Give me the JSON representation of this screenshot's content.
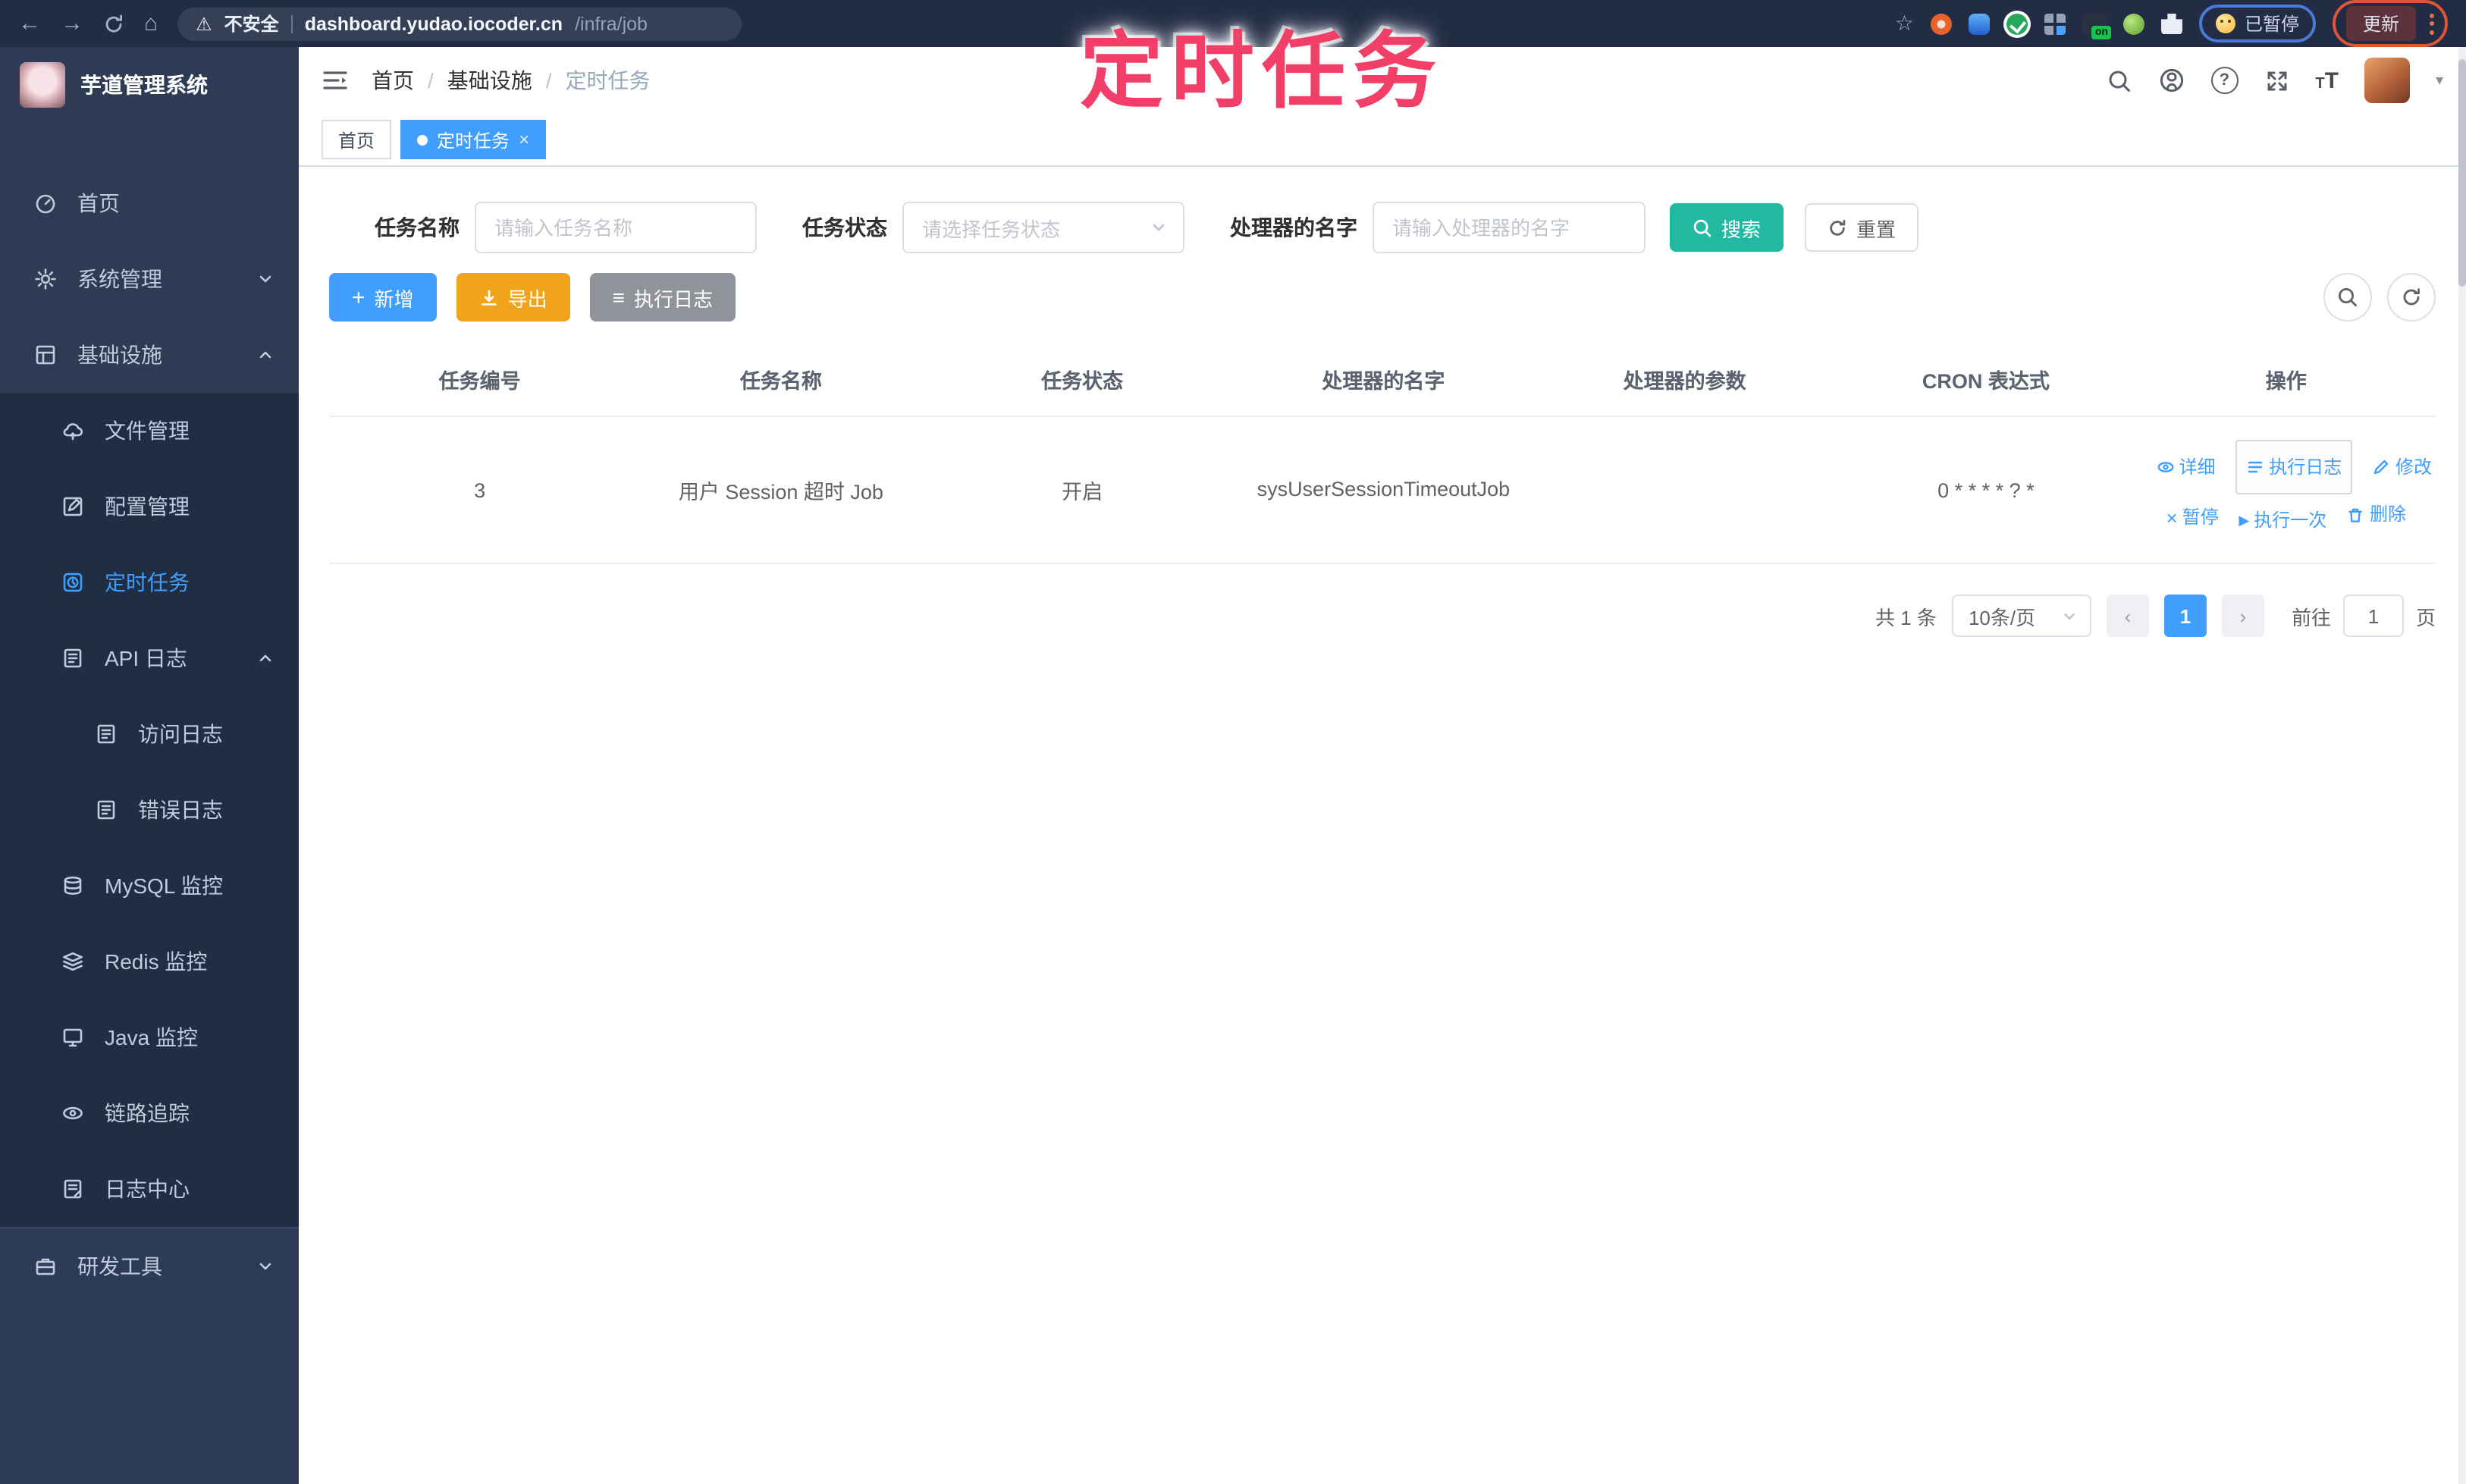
{
  "browser": {
    "security_label": "不安全",
    "url_host": "dashboard.yudao.iocoder.cn",
    "url_path": "/infra/job",
    "extension_on_badge": "on",
    "paused_badge": "已暂停",
    "update_button": "更新"
  },
  "glyphs": {
    "back": "←",
    "forward": "→",
    "home": "⌂",
    "warning": "⚠",
    "star": "☆",
    "close": "×",
    "sep": "/",
    "prev": "‹",
    "next": "›",
    "play": "▶",
    "pause": "×",
    "list": "≡",
    "plus": "+",
    "caret": "▾",
    "question": "?"
  },
  "annotation": {
    "text": "定时任务"
  },
  "sidebar": {
    "title": "芋道管理系统",
    "items": [
      {
        "label": "首页"
      },
      {
        "label": "系统管理"
      },
      {
        "label": "基础设施"
      },
      {
        "label": "文件管理"
      },
      {
        "label": "配置管理"
      },
      {
        "label": "定时任务"
      },
      {
        "label": "API 日志"
      },
      {
        "label": "访问日志"
      },
      {
        "label": "错误日志"
      },
      {
        "label": "MySQL 监控"
      },
      {
        "label": "Redis 监控"
      },
      {
        "label": "Java 监控"
      },
      {
        "label": "链路追踪"
      },
      {
        "label": "日志中心"
      },
      {
        "label": "研发工具"
      }
    ]
  },
  "navbar": {
    "breadcrumb": [
      "首页",
      "基础设施",
      "定时任务"
    ],
    "font_size_icon": "T"
  },
  "tabs": [
    {
      "label": "首页"
    },
    {
      "label": "定时任务"
    }
  ],
  "filters": {
    "name_label": "任务名称",
    "name_placeholder": "请输入任务名称",
    "status_label": "任务状态",
    "status_placeholder": "请选择任务状态",
    "handler_label": "处理器的名字",
    "handler_placeholder": "请输入处理器的名字",
    "search_label": "搜索",
    "reset_label": "重置"
  },
  "toolbar": {
    "add_label": "新增",
    "export_label": "导出",
    "exec_log_label": "执行日志"
  },
  "table": {
    "columns": [
      "任务编号",
      "任务名称",
      "任务状态",
      "处理器的名字",
      "处理器的参数",
      "CRON 表达式",
      "操作"
    ],
    "rows": [
      {
        "id": "3",
        "name": "用户 Session 超时 Job",
        "status": "开启",
        "handler": "sysUserSessionTimeoutJob",
        "param": "",
        "cron": "0 * * * * ? *"
      }
    ],
    "row_actions": [
      "详细",
      "执行日志",
      "修改",
      "暂停",
      "执行一次",
      "删除"
    ]
  },
  "pagination": {
    "total": "共 1 条",
    "page_size": "10条/页",
    "current_page": "1",
    "goto_label": "前往",
    "goto_value": "1",
    "page_label": "页"
  }
}
